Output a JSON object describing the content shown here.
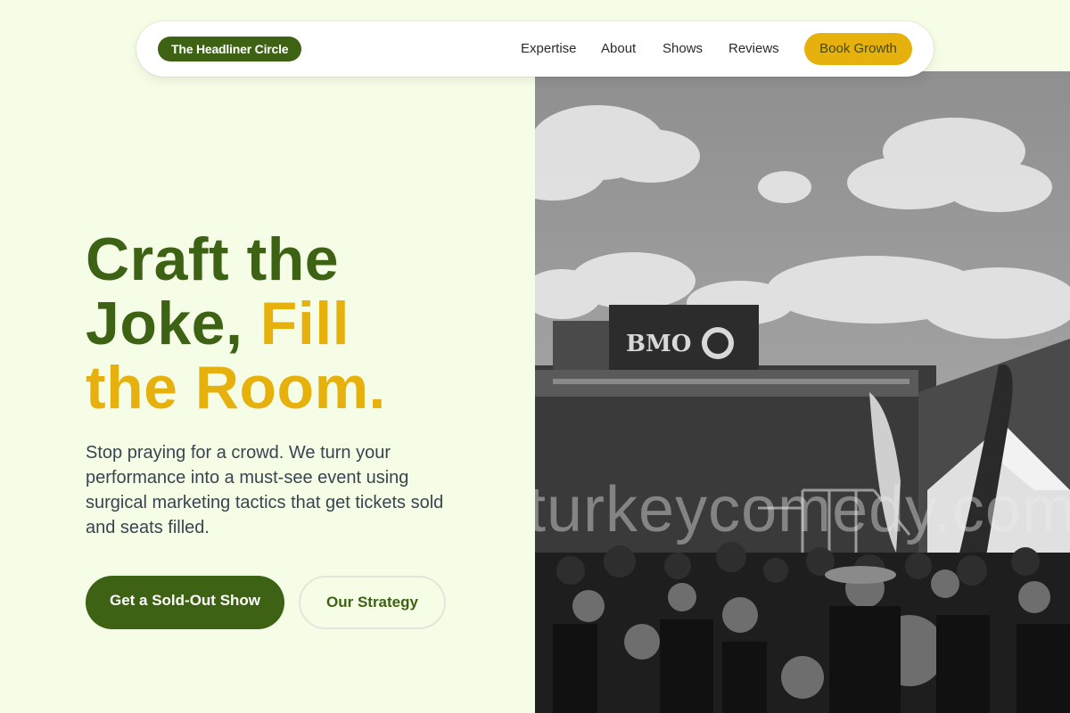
{
  "nav": {
    "brand": "The Headliner Circle",
    "links": [
      "Expertise",
      "About",
      "Shows",
      "Reviews"
    ],
    "cta": "Book Growth"
  },
  "hero": {
    "headline_part1": "Craft the",
    "headline_part2": "Joke,",
    "headline_part3": "Fill",
    "headline_part4": "the Room.",
    "subtext": "Stop praying for a crowd. We turn your performance into a must-see event using surgical marketing tactics that get tickets sold and seats filled.",
    "primary_cta": "Get a Sold-Out Show",
    "secondary_cta": "Our Strategy"
  },
  "photo": {
    "sign_text": "BMO",
    "watermark": "turkeycomedy.com"
  },
  "colors": {
    "background": "#f6fde6",
    "brand_green": "#3d6214",
    "accent_gold": "#e6b10c"
  }
}
